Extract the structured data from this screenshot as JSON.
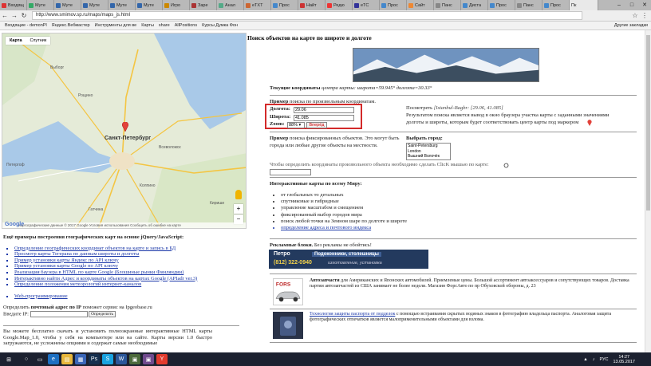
{
  "browser": {
    "tabs": [
      "Входящ",
      "Муте",
      "Муте",
      "Муте",
      "Муте",
      "Муте",
      "Игро",
      "Заре",
      "Анал",
      "eTXT",
      "Прос",
      "Найт",
      "Редю",
      "eTC",
      "Прос",
      "Сайт",
      "Панс",
      "Диста",
      "Прос",
      "Панс",
      "Прос"
    ],
    "active_tab": "Пк",
    "url": "http://www.smimov.sp.ru/maps/maps_js.html",
    "bookmarks": [
      "Входящие - demonPl",
      "Яндекс.Вебмастер",
      "Инструменты для ве",
      "Карты",
      "share",
      "AllPositions",
      "Курсы Думка Фон"
    ],
    "bookmarks_other": "Другие закладки"
  },
  "map": {
    "tab_map": "Карта",
    "tab_satellite": "Спутник",
    "city": "Санкт-Петербург",
    "places": [
      "Выборг",
      "Петергоф",
      "Гатчина",
      "Всеволожск",
      "Колпино",
      "Кириши",
      "Рощино"
    ],
    "footer": "Картографические данные © 2017 Google  Условия использования  Сообщить об ошибке на карте",
    "google": "Google",
    "zoom_in": "+",
    "zoom_out": "−"
  },
  "page": {
    "title": "Поиск объектов на карте по широте и долготе",
    "current_coords_label": "Текущие координаты",
    "current_coords_text": "центра карты: широта=59.945° долгота=30.33°",
    "example_label": "Пример",
    "example_text": "поиска по произвольным координатам.",
    "lon_label": "Долгота:",
    "lon_value": "29.06",
    "lat_label": "Широта:",
    "lat_value": "41.085",
    "zoom_label": "Zoom:",
    "zoom_value": "88%",
    "goto_button": "Вперёд",
    "see_label": "Посмотреть",
    "see_link": "[Istanbul-Bagbr: [29.06, 41.085]",
    "see_text": "Результатом поиска является вывод в окно браузера участка карты с заданными значениями долготы и широты, которым будет соответствовать центр карты под маркером",
    "fixed_label": "Пример",
    "fixed_text": "поиска фиксированных объектов. Это могут быть города или любые другие объекты на местности.",
    "choose_city": "Выбрать город:",
    "cities": [
      "Saint-Petersburg",
      "London",
      "Вышний Волочёк"
    ],
    "click_text": "Чтобы определить координаты произвольного объекта необходимо сделать ClicK мышью по карте:",
    "interactive_title": "Интерактивные карты по всему Миру:",
    "interactive_items": [
      "от глобальных то детальных",
      "спутниковые и гибридные",
      "управление масштабом и смещением",
      "фиксированный выбор городов мира",
      "поиск любой точки на Земном шаре по долготе и широте",
      "определение адреса и почтового индекса"
    ],
    "ads_title": "Рекламные блоки.",
    "ads_text": "Без рекламы не обойтись!",
    "ad1_brand": "Петро",
    "ad1_title": "Подоконники, столешницы",
    "ad1_phone": "(812) 322-0940",
    "ad1_sub": "изготовление, установка",
    "ad2_title": "Автозапчасти",
    "ad2_text": "для Американских и Японских автомобилей. Приемлемые цены. Большой ассортимент автоаксессуаров и сопутствующих товаров. Доставка партии автозапчастей из США занимает не более недели. Магазин ФорсАвто по пр Обуховской обороны, д. 23",
    "ad3_link": "Технология защиты паспорта от подделок",
    "ad3_text": "с помощью встраивания скрытых водяных знаков в фотографию владельца паспорта. Аналоговая защита фотографических отпечатков является малоприменительными объектами для взлома."
  },
  "left": {
    "examples_title": "Ещё примеры построения географических карт на основе jQuery/JavaScript:",
    "links": [
      "Определение географических координат объектов на карте и запись в БД",
      "Просмотр карты Тегерана по данным широты и долготы",
      "Пример установки карты Яндекс по API ключу",
      "Пример установки карты Google по API ключу",
      "Реализация баузера в HTML по карте Google (Блошиные рынки Финляндии)",
      "Интерактивно найти Адрес и координаты объектов на картах Google (APIadr ver.3)",
      "Определение положения метеорологий интернет-каналов"
    ],
    "web_prog": "Web-программирование",
    "ip_text1": "Определить",
    "ip_bold": "почтовый адрес по IP",
    "ip_text2": "поможет сервис на Ipgeobase.ru",
    "ip_label": "Введите IP:",
    "ip_button": "Определить",
    "bottom_text": "Вы можете бесплатно скачать и установить полноэкранные интерактивные HTML карты Google.Map_1.0, чтобы у себя на компьютере или на сайте. Карты версии 1.0 быстро загружаются, не усложнены опциями и содержат самые необходимые"
  },
  "taskbar": {
    "lang": "РУС",
    "time": "14:27",
    "date": "13.05.2017"
  }
}
